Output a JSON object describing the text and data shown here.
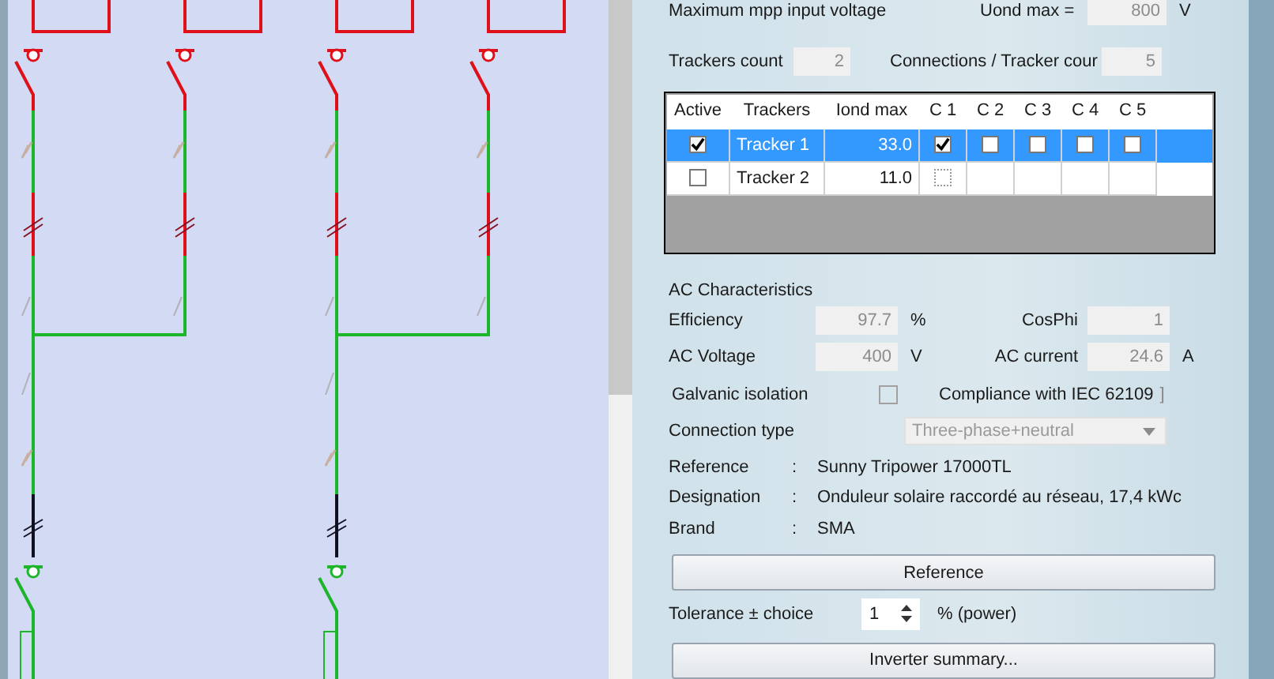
{
  "mpp": {
    "label": "Maximum mpp input voltage",
    "uond_label": "Uond max =",
    "uond_value": "800",
    "unit": "V"
  },
  "trackers": {
    "count_label": "Trackers count",
    "count": "2",
    "connections_label": "Connections / Tracker cour",
    "connections": "5"
  },
  "table": {
    "columns": [
      "Active",
      "Trackers",
      "Iond max",
      "C 1",
      "C 2",
      "C 3",
      "C 4",
      "C 5"
    ],
    "rows": [
      {
        "selected": true,
        "active": true,
        "name": "Tracker 1",
        "iond_max": "33.0",
        "connections": [
          {
            "kind": "checkbox",
            "checked": true
          },
          {
            "kind": "checkbox",
            "checked": false
          },
          {
            "kind": "checkbox",
            "checked": false
          },
          {
            "kind": "checkbox",
            "checked": false
          },
          {
            "kind": "checkbox",
            "checked": false
          }
        ]
      },
      {
        "selected": false,
        "active": false,
        "name": "Tracker 2",
        "iond_max": "11.0",
        "connections": [
          {
            "kind": "dotted",
            "checked": false
          },
          {
            "kind": "empty"
          },
          {
            "kind": "empty"
          },
          {
            "kind": "empty"
          },
          {
            "kind": "empty"
          }
        ]
      }
    ]
  },
  "ac": {
    "title": "AC Characteristics",
    "fields": [
      {
        "label": "Efficiency",
        "value": "97.7",
        "unit": "%"
      },
      {
        "label": "CosPhi",
        "value": "1"
      },
      {
        "label": "AC Voltage",
        "value": "400",
        "unit": "V"
      },
      {
        "label": "AC current",
        "value": "24.6",
        "unit": "A"
      }
    ]
  },
  "galvanic": {
    "label": "Galvanic isolation",
    "checked": false
  },
  "compliance": {
    "label": "Compliance with IEC 62109",
    "bracket": "]"
  },
  "connection_type": {
    "label": "Connection type",
    "value": "Three-phase+neutral",
    "disabled": true
  },
  "info": [
    {
      "label": "Reference",
      "sep": ":",
      "value": "Sunny Tripower 17000TL"
    },
    {
      "label": "Designation",
      "sep": ":",
      "value": "Onduleur solaire raccordé au réseau, 17,4 kWc"
    },
    {
      "label": "Brand",
      "sep": ":",
      "value": "SMA"
    }
  ],
  "reference_button": "Reference",
  "tolerance": {
    "label": "Tolerance ± choice",
    "value": "1",
    "unit": "% (power)"
  },
  "summary_button": "Inverter summary..."
}
